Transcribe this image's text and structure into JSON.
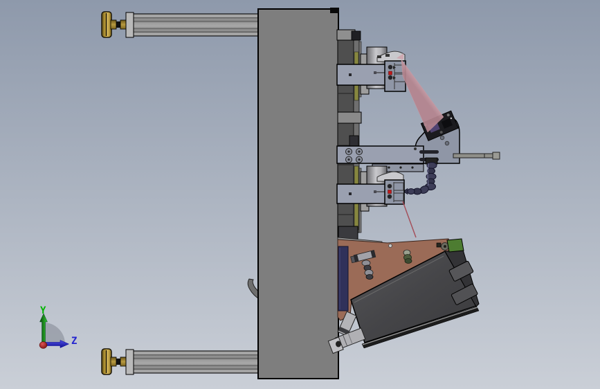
{
  "axis_triad": {
    "y_label": "Y",
    "z_label": "Z"
  },
  "colors": {
    "bg_top": "#8e99ab",
    "bg_bottom": "#cacfd7",
    "plate": "#7e7e7e",
    "arm": "#9aa0b0",
    "bracket": "#8f96a6",
    "rail_dark": "#4f4f4f",
    "rail_mid": "#6f6f6f",
    "guide_olive": "#87873f",
    "carriage": "#9e9e9e",
    "beam_pink": "#c89ca6",
    "laser_red": "#a34550",
    "hose": "#3d3d58",
    "tray_brown": "#9b6b57",
    "panel_navy": "#30315a",
    "box_dark": "#474747",
    "box_green": "#4d7c31",
    "bumper_gold": "#c4a23c",
    "axis_y_green": "#00b400",
    "axis_z_blue": "#2525cf",
    "axis_x_red": "#a31515"
  }
}
